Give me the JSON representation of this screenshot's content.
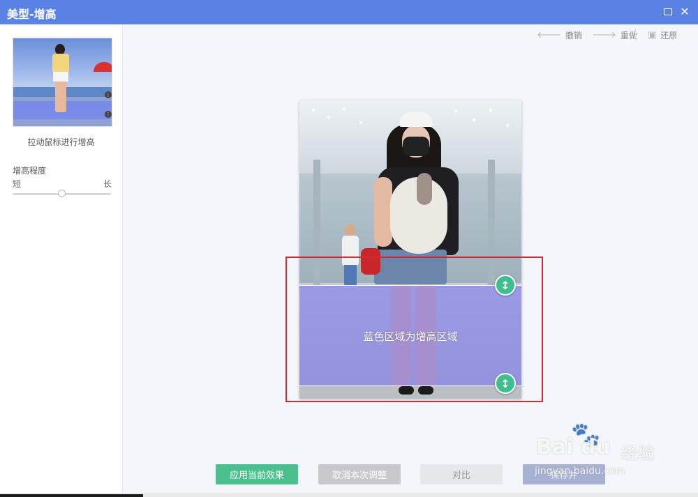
{
  "window": {
    "title": "美型-增高",
    "maximize_icon": "maximize-icon",
    "close_icon": "close-icon",
    "close_glyph": "✕"
  },
  "sidebar": {
    "hint": "拉动鼠标进行增高",
    "degree": {
      "label": "增高程度",
      "min_label": "短",
      "max_label": "长",
      "value_fraction": 0.5
    }
  },
  "toolbar": {
    "undo": {
      "label": "撤销",
      "icon": "arrow-left-icon",
      "glyph": "🡐"
    },
    "redo": {
      "label": "重做",
      "icon": "arrow-right-icon",
      "glyph": "🡒"
    },
    "restore": {
      "label": "还原",
      "icon": "image-restore-icon",
      "glyph": "▣"
    }
  },
  "canvas": {
    "stretch_zone_label": "蓝色区域为增高区域",
    "handle_glyph": "↕",
    "zone_color": "#6e68f8",
    "handle_color": "#3fbf8d",
    "highlight_color": "#e0262d"
  },
  "actions": {
    "apply": "应用当前效果",
    "cancel": "取消本次调整",
    "compare": "对比",
    "save": "保存并"
  },
  "watermark": {
    "logo": "Bai du",
    "product": "经验",
    "url": "jingyan.baidu.com"
  },
  "colors": {
    "titlebar": "#5a82e4",
    "apply_button": "#4ac08f"
  }
}
